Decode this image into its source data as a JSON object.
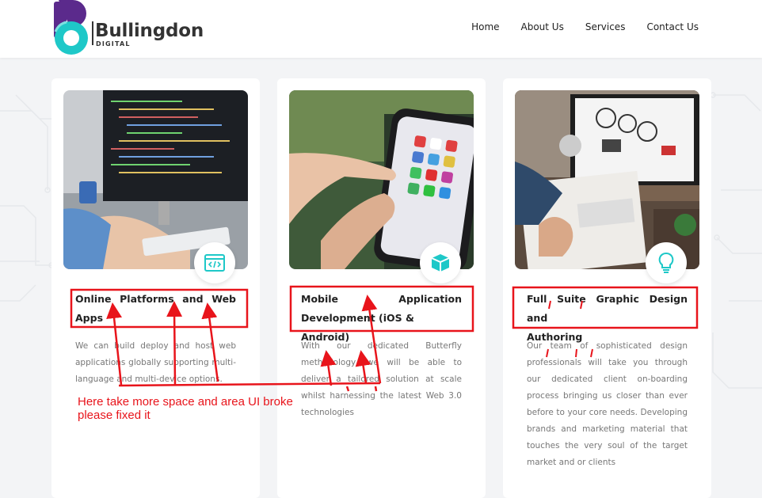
{
  "brand": {
    "name": "Bullingdon",
    "sub": "DIGITAL"
  },
  "nav": [
    "Home",
    "About Us",
    "Services",
    "Contact Us"
  ],
  "cards": [
    {
      "title_main": "Online Platforms and Web",
      "title_last": "Apps",
      "desc": "We can build deploy and host web applications globally supporting multi-language and multi-device options.",
      "icon": "code-window-icon",
      "image": "code-monitor-photo"
    },
    {
      "title_main": "Mobile Application",
      "title_last": "Development (iOS & Android)",
      "desc": "With our dedicated Butterfly methodology, we will be able to deliver a tailored solution at scale whilst harnessing the latest Web 3.0 technologies",
      "icon": "cube-icon",
      "image": "smartphone-photo"
    },
    {
      "title_main": "Full Suite Graphic Design and",
      "title_last": "Authoring",
      "desc": "Our team of sophisticated design professionals will take you through our dedicated client on-boarding process bringing us closer than ever before to your core needs. Developing brands and marketing material that touches the very soul of the target market and or clients",
      "icon": "lightbulb-icon",
      "image": "design-desk-photo"
    }
  ],
  "annotation": {
    "line1": "Here take more space and area UI broke",
    "line2": "please fixed it"
  },
  "colors": {
    "accent": "#1ec8c8",
    "annotation": "#e8141b",
    "logo_purple": "#5b2a8c"
  }
}
